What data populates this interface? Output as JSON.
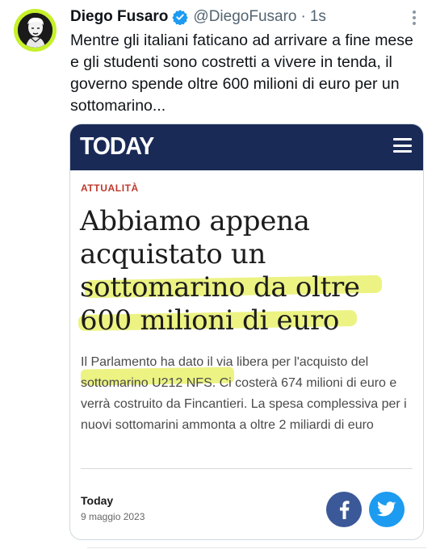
{
  "tweet": {
    "author_name": "Diego Fusaro",
    "handle": "@DiegoFusaro",
    "separator": "·",
    "time": "1s",
    "text": "Mentre gli italiani faticano ad arrivare a fine mese e gli studenti sono costretti a vivere in tenda, il governo spende oltre 600 milioni di euro per un sottomarino..."
  },
  "icons": {
    "verified": "verified-badge-icon",
    "more": "more-options-icon",
    "menu": "hamburger-menu-icon",
    "facebook": "facebook-icon",
    "twitter": "twitter-bird-icon"
  },
  "card": {
    "logo": "TODAY",
    "category": "ATTUALITÀ",
    "headline": "Abbiamo appena acquistato un sottomarino da oltre 600 milioni di euro",
    "summary": "Il Parlamento ha dato il via libera per l'acquisto del sottomarino U212 NFS. Ci costerà 674 milioni di euro e verrà costruito da Fincantieri. La spesa complessiva per i nuovi sottomarini ammonta a oltre 2 miliardi di euro",
    "source": "Today",
    "date": "9 maggio 2023"
  },
  "colors": {
    "brand_bar": "#1a2a57",
    "category": "#c0392b",
    "highlight": "#e6ef5a",
    "facebook": "#3b5998",
    "twitter": "#1d9bf0",
    "avatar_ring": "#c6f02a"
  }
}
